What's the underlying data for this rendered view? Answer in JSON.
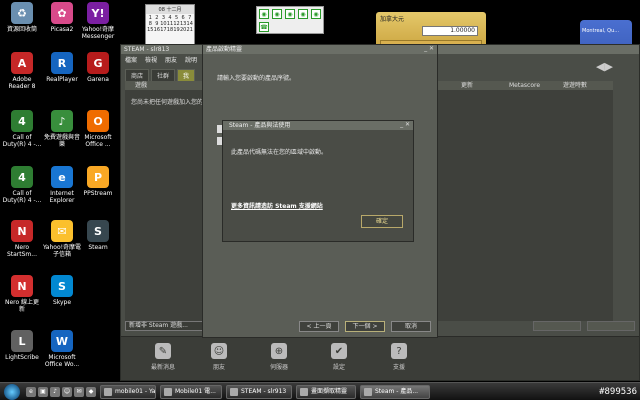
{
  "desktop_icons": [
    {
      "label": "資源回收筒",
      "glyph": "♻",
      "color": "#6a8fb0",
      "icon": "recycle-bin-icon"
    },
    {
      "label": "Picasa2",
      "glyph": "✿",
      "color": "#d84a8a",
      "icon": "picasa-icon"
    },
    {
      "label": "Yahoo!奇摩 Messenger",
      "glyph": "Y!",
      "color": "#7b1fa2",
      "icon": "yahoo-messenger-icon"
    },
    {
      "label": "Adobe Reader 8",
      "glyph": "A",
      "color": "#c62828",
      "icon": "adobe-reader-icon"
    },
    {
      "label": "RealPlayer",
      "glyph": "R",
      "color": "#1565c0",
      "icon": "realplayer-icon"
    },
    {
      "label": "Garena",
      "glyph": "G",
      "color": "#b71c1c",
      "icon": "garena-icon"
    },
    {
      "label": "Call of Duty(R) 4 -...",
      "glyph": "4",
      "color": "#2e7d32",
      "icon": "call-of-duty-icon"
    },
    {
      "label": "免費遊戲與音樂",
      "glyph": "♪",
      "color": "#388e3c",
      "icon": "free-games-icon"
    },
    {
      "label": "Microsoft Office ...",
      "glyph": "O",
      "color": "#ef6c00",
      "icon": "office-icon"
    },
    {
      "label": "Call of Duty(R) 4 -...",
      "glyph": "4",
      "color": "#2e7d32",
      "icon": "call-of-duty-icon"
    },
    {
      "label": "Internet Explorer",
      "glyph": "e",
      "color": "#1976d2",
      "icon": "internet-explorer-icon"
    },
    {
      "label": "PPStream",
      "glyph": "P",
      "color": "#f9a825",
      "icon": "ppstream-icon"
    },
    {
      "label": "Nero StartSm...",
      "glyph": "N",
      "color": "#c62828",
      "icon": "nero-icon"
    },
    {
      "label": "Yahoo!奇摩電子信箱",
      "glyph": "✉",
      "color": "#fbc02d",
      "icon": "yahoo-mail-icon"
    },
    {
      "label": "Steam",
      "glyph": "S",
      "color": "#37474f",
      "icon": "steam-icon"
    },
    {
      "label": "Nero 線上更新",
      "glyph": "N",
      "color": "#d32f2f",
      "icon": "nero-update-icon"
    },
    {
      "label": "Skype",
      "glyph": "S",
      "color": "#0288d1",
      "icon": "skype-icon"
    },
    {
      "label": "LightScribe",
      "glyph": "L",
      "color": "#616161",
      "icon": "lightscribe-icon"
    },
    {
      "label": "Microsoft Office Wo...",
      "glyph": "W",
      "color": "#1565c0",
      "icon": "word-icon"
    }
  ],
  "calendar": {
    "header": "08 十二月",
    "days": [
      "1",
      "2",
      "3",
      "4",
      "5",
      "6",
      "7",
      "8",
      "9",
      "10",
      "11",
      "12",
      "13",
      "14",
      "15",
      "16",
      "17",
      "18",
      "19",
      "20",
      "21"
    ]
  },
  "currency": {
    "title": "加拿大元",
    "value": "1.00000"
  },
  "weather": {
    "label": "Montreal, Qu..."
  },
  "steam": {
    "title": "STEAM - slr813",
    "menu": [
      "檔案",
      "檢視",
      "朋友",
      "說明"
    ],
    "tabs": [
      "商店",
      "社群",
      "我"
    ],
    "list_headers": {
      "games": "遊戲",
      "updates": "更新",
      "metascore": "Metascore",
      "time": "遊遊時數"
    },
    "empty_message": "您尚未把任何遊戲加入您的...",
    "add_game_button": "新增非 Steam 遊戲...",
    "bottom": [
      {
        "label": "最新消息",
        "glyph": "✎",
        "icon": "news-icon"
      },
      {
        "label": "朋友",
        "glyph": "☺",
        "icon": "friends-icon"
      },
      {
        "label": "伺服器",
        "glyph": "⊕",
        "icon": "servers-icon"
      },
      {
        "label": "設定",
        "glyph": "✔",
        "icon": "settings-icon"
      },
      {
        "label": "支援",
        "glyph": "?",
        "icon": "support-icon"
      }
    ]
  },
  "activation": {
    "title": "產品啟動精靈",
    "prompt": "請輸入您要啟動的產品序號。",
    "back": "< 上一頁",
    "next": "下一個 >",
    "cancel": "取消"
  },
  "popup": {
    "title": "Steam - 產品與法使用",
    "message": "此產品代碼無法在您的區域中啟動。",
    "link": "更多資訊請造訪 Steam 支援網站",
    "ok": "確定"
  },
  "taskbar": {
    "tasks": [
      "mobile01 - Ya...",
      "Mobile01 電...",
      "STEAM - slr913",
      "畫面擷取精靈",
      "Steam - 產品..."
    ],
    "watermark": "#899536"
  }
}
